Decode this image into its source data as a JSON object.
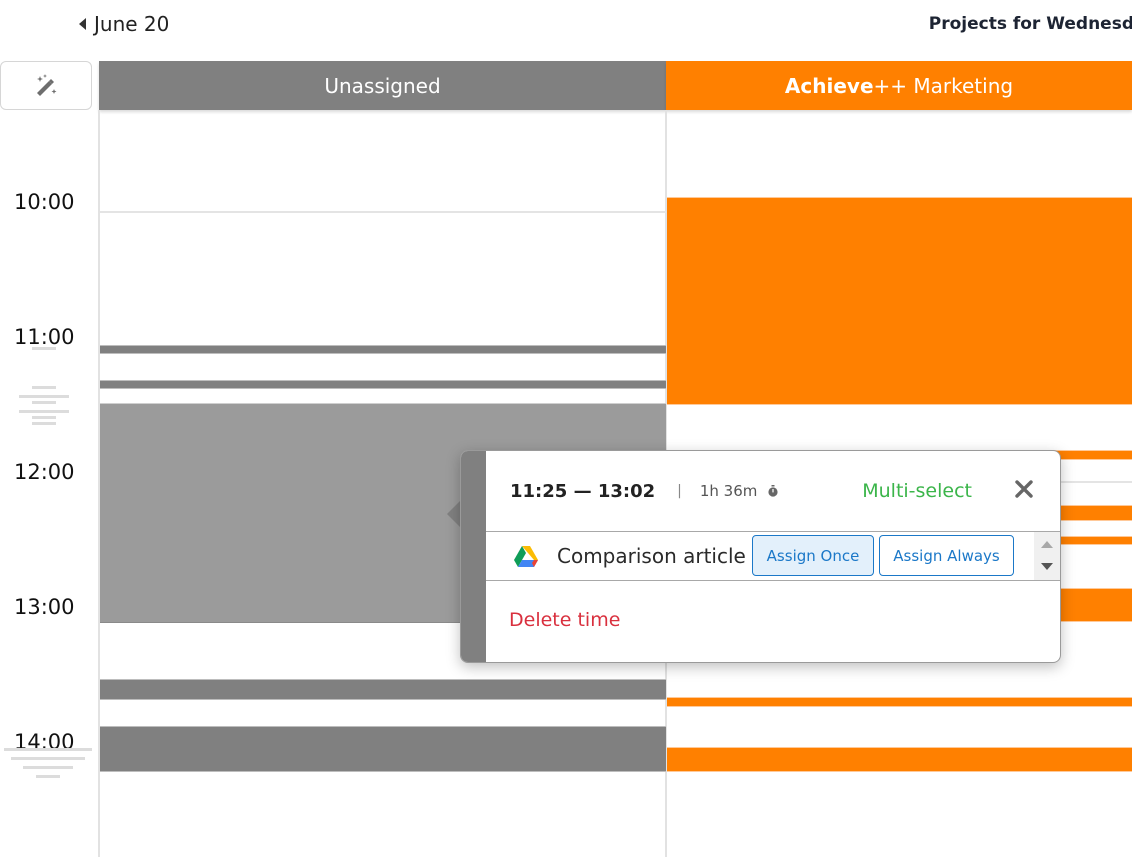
{
  "topbar": {
    "date_label": "June 20",
    "page_title": "Projects for Wednesd"
  },
  "toolbar": {
    "magic_wand_icon": "magic-wand-icon"
  },
  "columns": [
    {
      "name": "Unassigned",
      "color": "#808080"
    },
    {
      "brand_bold": "Achieve",
      "brand_plus": "++",
      "name_rest": " Marketing",
      "color": "#ff8000"
    }
  ],
  "timeline": {
    "hours": [
      "10:00",
      "11:00",
      "12:00",
      "13:00",
      "14:00"
    ]
  },
  "blocks": {
    "unassigned": [
      {
        "start": "11:00",
        "end": "11:04"
      },
      {
        "start": "11:13",
        "end": "11:16"
      },
      {
        "start": "11:25",
        "end": "13:02",
        "selected": true
      },
      {
        "start": "13:31",
        "end": "13:39"
      },
      {
        "start": "13:51",
        "end": "14:12"
      }
    ],
    "marketing": [
      {
        "start": "09:56",
        "end": "11:28"
      },
      {
        "start": "11:49",
        "end": "11:53"
      },
      {
        "start": "12:10",
        "end": "12:17"
      },
      {
        "start": "12:17",
        "end": "12:20"
      },
      {
        "start": "12:41",
        "end": "12:55"
      },
      {
        "start": "13:38",
        "end": "13:43"
      },
      {
        "start": "14:00",
        "end": "14:11"
      }
    ]
  },
  "popup": {
    "time_range": "11:25 — 13:02",
    "separator": "|",
    "duration": "1h 36m",
    "multi_select_label": "Multi-select",
    "project": {
      "icon": "google-drive-icon",
      "name": "Comparison article"
    },
    "assign_once_label": "Assign Once",
    "assign_always_label": "Assign Always",
    "delete_label": "Delete time"
  },
  "colors": {
    "unassigned": "#808080",
    "marketing": "#ff8000",
    "multi_select": "#3bb54a",
    "delete": "#d9303e",
    "assign_button": "#1b78c8"
  }
}
